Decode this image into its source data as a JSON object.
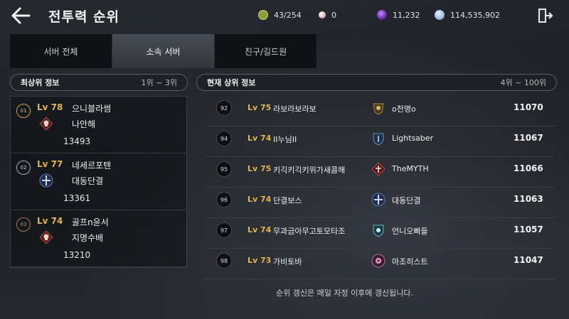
{
  "header": {
    "title": "전투력 순위",
    "resources": {
      "stamina": "43/254",
      "pearl": "0",
      "crystal": "11,232",
      "silver": "114,535,902"
    }
  },
  "tabs": [
    "서버 전체",
    "소속 서버",
    "친구/길드원"
  ],
  "active_tab": "소속 서버",
  "top_section": {
    "title": "최상위 정보",
    "range": "1위 ~ 3위"
  },
  "top_players": [
    {
      "rank": "01",
      "level": "Lv 78",
      "name": "으니블라썸",
      "guild": "나안해",
      "power": "13493",
      "emblem": "skull-emblem"
    },
    {
      "rank": "02",
      "level": "Lv 77",
      "name": "네세르포텐",
      "guild": "대동단결",
      "power": "13361",
      "emblem": "cross-emblem"
    },
    {
      "rank": "03",
      "level": "Lv 74",
      "name": "골프n윤서",
      "guild": "지명수배",
      "power": "13210",
      "emblem": "skull-emblem"
    }
  ],
  "rank_section": {
    "title": "현재 상위 정보",
    "range": "4위 ~ 100위"
  },
  "ranks": [
    {
      "rank": "92",
      "level": "Lv 75",
      "name": "라보라보라보",
      "guild": "o천명o",
      "power": "11070",
      "emblem": "helm-emblem"
    },
    {
      "rank": "94",
      "level": "Lv 74",
      "name": "II누님II",
      "guild": "Lightsaber",
      "power": "11067",
      "emblem": "shield-emblem"
    },
    {
      "rank": "95",
      "level": "Lv 75",
      "name": "키긱키긱키위가새콤해",
      "guild": "TheMYTH",
      "power": "11066",
      "emblem": "cross-emblem"
    },
    {
      "rank": "96",
      "level": "Lv 74",
      "name": "단결보스",
      "guild": "대동단결",
      "power": "11063",
      "emblem": "cross-emblem"
    },
    {
      "rank": "97",
      "level": "Lv 74",
      "name": "무과금아무고토모타조",
      "guild": "언니오빠들",
      "power": "11057",
      "emblem": "shield-emblem"
    },
    {
      "rank": "98",
      "level": "Lv 73",
      "name": "가비토바",
      "guild": "마조히스트",
      "power": "11047",
      "emblem": "rose-emblem"
    }
  ],
  "notice": "순위 갱신은 매일 자정 이후에 갱신됩니다.",
  "colors": {
    "level_gold": "#e3b54a",
    "active_tab": "#3d4047",
    "background": "#1a1d22"
  }
}
